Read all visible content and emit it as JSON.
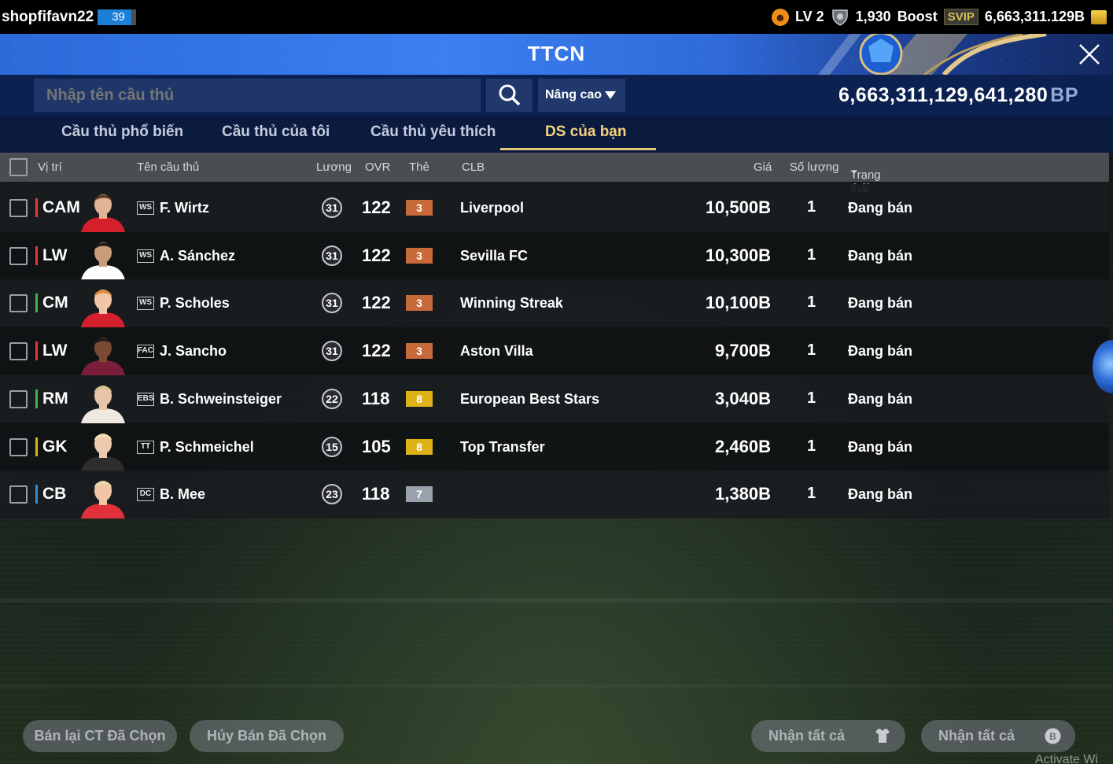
{
  "topbar": {
    "username": "shopfifavn22",
    "user_level": "39",
    "lv_label": "LV 2",
    "trophies": "1,930",
    "boost_label": "Boost",
    "svip_label": "SVIP",
    "balance": "6,663,311.129B"
  },
  "window": {
    "title": "TTCN"
  },
  "search": {
    "placeholder": "Nhập tên cầu thủ",
    "advanced_label": "Nâng cao",
    "bp_amount": "6,663,311,129,641,280",
    "bp_unit": "BP"
  },
  "tabs": [
    {
      "label": "Cầu thủ phổ biến"
    },
    {
      "label": "Cầu thủ của tôi"
    },
    {
      "label": "Cầu thủ yêu thích"
    },
    {
      "label": "DS của bạn",
      "active": true
    }
  ],
  "columns": {
    "position": "Vị trí",
    "name": "Tên cầu thủ",
    "wage": "Lương",
    "ovr": "OVR",
    "card": "Thẻ",
    "club": "CLB",
    "price": "Giá",
    "quantity": "Số lượng",
    "status": "Trạng thái"
  },
  "rows": [
    {
      "position": "CAM",
      "pos_color": "#e23a3a",
      "season": "WS",
      "name": "F. Wirtz",
      "wage": "31",
      "ovr": "122",
      "card": "3",
      "card_color": "#c8693a",
      "club": "Liverpool",
      "price": "10,500B",
      "quantity": "1",
      "status": "Đang bán"
    },
    {
      "position": "LW",
      "pos_color": "#e23a3a",
      "season": "WS",
      "name": "A. Sánchez",
      "wage": "31",
      "ovr": "122",
      "card": "3",
      "card_color": "#c8693a",
      "club": "Sevilla FC",
      "price": "10,300B",
      "quantity": "1",
      "status": "Đang bán"
    },
    {
      "position": "CM",
      "pos_color": "#38b84a",
      "season": "WS",
      "name": "P. Scholes",
      "wage": "31",
      "ovr": "122",
      "card": "3",
      "card_color": "#c8693a",
      "club": "Winning Streak",
      "price": "10,100B",
      "quantity": "1",
      "status": "Đang bán"
    },
    {
      "position": "LW",
      "pos_color": "#e23a3a",
      "season": "FAC",
      "name": "J. Sancho",
      "wage": "31",
      "ovr": "122",
      "card": "3",
      "card_color": "#c8693a",
      "club": "Aston Villa",
      "price": "9,700B",
      "quantity": "1",
      "status": "Đang bán"
    },
    {
      "position": "RM",
      "pos_color": "#38b84a",
      "season": "EBS",
      "name": "B. Schweinsteiger",
      "wage": "22",
      "ovr": "118",
      "card": "8",
      "card_color": "#e0b21a",
      "club": "European Best Stars",
      "price": "3,040B",
      "quantity": "1",
      "status": "Đang bán"
    },
    {
      "position": "GK",
      "pos_color": "#e0b21a",
      "season": "TT",
      "name": "P. Schmeichel",
      "wage": "15",
      "ovr": "105",
      "card": "8",
      "card_color": "#e0b21a",
      "club": "Top Transfer",
      "price": "2,460B",
      "quantity": "1",
      "status": "Đang bán"
    },
    {
      "position": "CB",
      "pos_color": "#2f8be0",
      "season": "DC",
      "name": "B. Mee",
      "wage": "23",
      "ovr": "118",
      "card": "7",
      "card_color": "#9aa3ad",
      "club": "",
      "price": "1,380B",
      "quantity": "1",
      "status": "Đang bán"
    }
  ],
  "footer": {
    "resell_label": "Bán lại CT Đã Chọn",
    "cancel_label": "Hủy Bán Đã Chọn",
    "claim_all_label": "Nhận tất cả",
    "claim_all_label_2": "Nhận tất cả",
    "watermark": "Activate Wi"
  },
  "icons": [
    "face-level-icon",
    "shield-trophy-icon",
    "coins-icon",
    "close-icon",
    "search-icon",
    "dropdown-arrow-icon",
    "shirt-icon",
    "bp-coin-icon"
  ]
}
